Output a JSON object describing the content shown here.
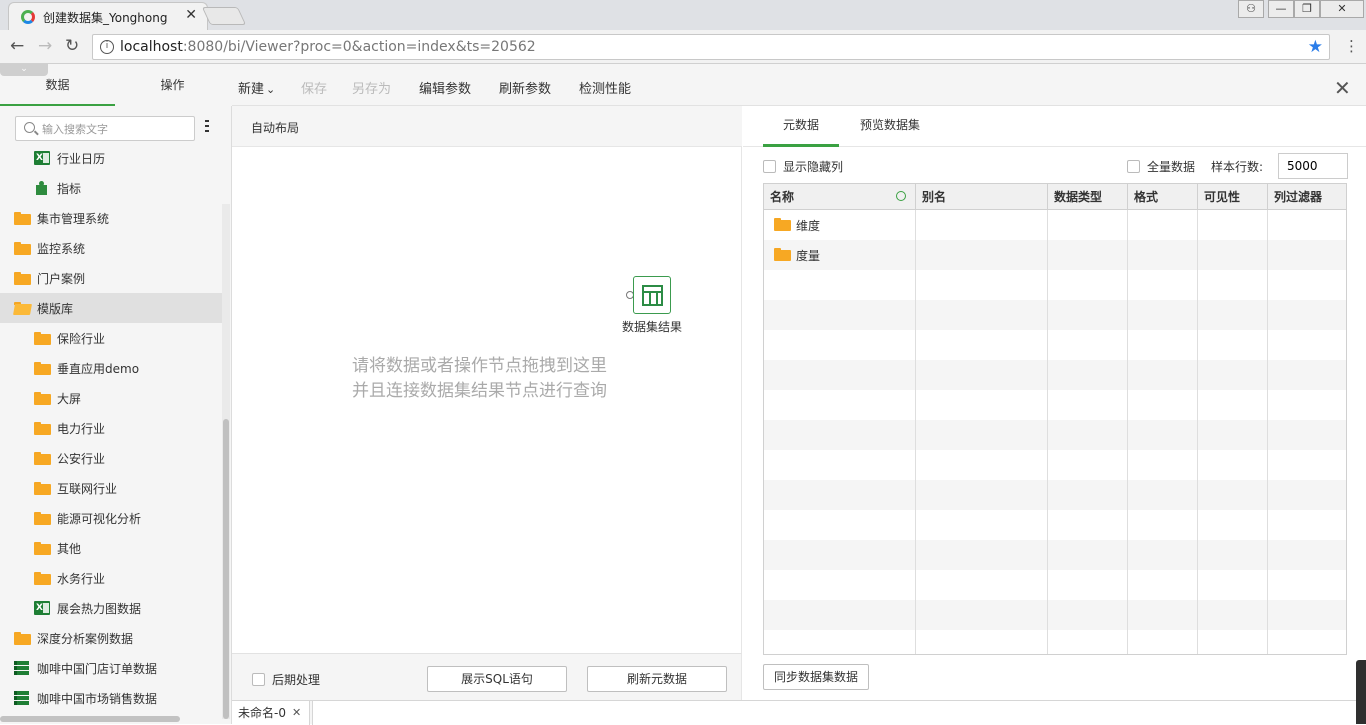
{
  "browser": {
    "tab_title": "创建数据集_Yonghong",
    "tab_close": "✕",
    "url_host": "localhost",
    "url_rest": ":8080/bi/Viewer?proc=0&action=index&ts=20562",
    "back": "←",
    "forward": "→",
    "reload": "↻",
    "star": "★",
    "info": "i",
    "menu": "⋮",
    "win_user": "⚇",
    "win_min": "—",
    "win_max": "❐",
    "win_close": "✕"
  },
  "left_panel": {
    "tabs": [
      {
        "label": "数据"
      },
      {
        "label": "操作"
      }
    ],
    "collapse": "⌄",
    "search_placeholder": "输入搜索文字",
    "tree": [
      {
        "label": "行业日历",
        "icon": "excel-icon",
        "indent": 1
      },
      {
        "label": "指标",
        "icon": "puzzle-icon",
        "indent": 1
      },
      {
        "label": "集市管理系统",
        "icon": "folder-icon",
        "indent": 0
      },
      {
        "label": "监控系统",
        "icon": "folder-icon",
        "indent": 0
      },
      {
        "label": "门户案例",
        "icon": "folder-icon",
        "indent": 0
      },
      {
        "label": "模版库",
        "icon": "folder-open-icon",
        "indent": 0,
        "selected": true
      },
      {
        "label": "保险行业",
        "icon": "folder-icon",
        "indent": 1
      },
      {
        "label": "垂直应用demo",
        "icon": "folder-icon",
        "indent": 1
      },
      {
        "label": "大屏",
        "icon": "folder-icon",
        "indent": 1
      },
      {
        "label": "电力行业",
        "icon": "folder-icon",
        "indent": 1
      },
      {
        "label": "公安行业",
        "icon": "folder-icon",
        "indent": 1
      },
      {
        "label": "互联网行业",
        "icon": "folder-icon",
        "indent": 1
      },
      {
        "label": "能源可视化分析",
        "icon": "folder-icon",
        "indent": 1
      },
      {
        "label": "其他",
        "icon": "folder-icon",
        "indent": 1
      },
      {
        "label": "水务行业",
        "icon": "folder-icon",
        "indent": 1
      },
      {
        "label": "展会热力图数据",
        "icon": "excel-icon",
        "indent": 1
      },
      {
        "label": "深度分析案例数据",
        "icon": "folder-icon",
        "indent": 0
      },
      {
        "label": "咖啡中国门店订单数据",
        "icon": "database-icon",
        "indent": 0
      },
      {
        "label": "咖啡中国市场销售数据",
        "icon": "database-icon",
        "indent": 0
      }
    ]
  },
  "toolbar": {
    "new_label": "新建",
    "new_caret": "⌄",
    "save_label": "保存",
    "save_as_label": "另存为",
    "edit_params_label": "编辑参数",
    "refresh_params_label": "刷新参数",
    "check_perf_label": "检测性能",
    "close": "✕"
  },
  "canvas": {
    "auto_layout_label": "自动布局",
    "node_label": "数据集结果",
    "hint_line1": "请将数据或者操作节点拖拽到这里",
    "hint_line2": "并且连接数据集结果节点进行查询",
    "post_process_label": "后期处理",
    "show_sql_label": "展示SQL语句",
    "refresh_meta_label": "刷新元数据"
  },
  "right_panel": {
    "tabs": [
      {
        "label": "元数据"
      },
      {
        "label": "预览数据集"
      }
    ],
    "show_hidden_label": "显示隐藏列",
    "all_data_label": "全量数据",
    "sample_rows_label": "样本行数:",
    "sample_rows_value": "5000",
    "columns": [
      {
        "label": "名称"
      },
      {
        "label": "别名"
      },
      {
        "label": "数据类型"
      },
      {
        "label": "格式"
      },
      {
        "label": "可见性"
      },
      {
        "label": "列过滤器"
      }
    ],
    "rows": [
      {
        "name": "维度"
      },
      {
        "name": "度量"
      }
    ],
    "sync_label": "同步数据集数据"
  },
  "bottom_tabs": {
    "tab_label": "未命名-0",
    "tab_close": "✕"
  }
}
